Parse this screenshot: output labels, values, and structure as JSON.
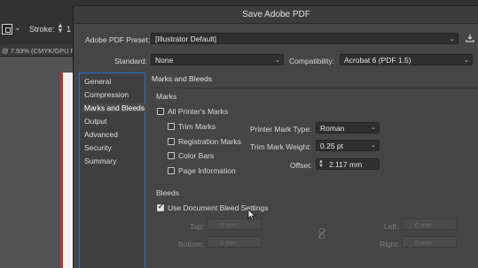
{
  "app": {
    "stroke_label": "Stroke:",
    "stroke_value": "1",
    "doc_tab": "@ 7.93% (CMYK/GPU Pr"
  },
  "dialog": {
    "title": "Save Adobe PDF",
    "preset_label": "Adobe PDF Preset:",
    "preset_value": "[Illustrator Default]",
    "standard_label": "Standard:",
    "standard_value": "None",
    "compat_label": "Compatibility:",
    "compat_value": "Acrobat 6 (PDF 1.5)",
    "sidebar": [
      "General",
      "Compression",
      "Marks and Bleeds",
      "Output",
      "Advanced",
      "Security",
      "Summary"
    ],
    "active_index": 2,
    "panel_title": "Marks and Bleeds",
    "marks": {
      "section": "Marks",
      "all_printers": "All Printer's Marks",
      "trim": "Trim Marks",
      "registration": "Registration Marks",
      "color_bars": "Color Bars",
      "page_info": "Page Information",
      "type_label": "Printer Mark Type:",
      "type_value": "Roman",
      "weight_label": "Trim Mark Weight:",
      "weight_value": "0.25 pt",
      "offset_label": "Offset:",
      "offset_value": "2.117 mm"
    },
    "bleeds": {
      "section": "Bleeds",
      "use_doc": "Use Document Bleed Settings",
      "use_doc_checked": true,
      "top_label": "Top:",
      "top_value": "0 mm",
      "bottom_label": "Bottom:",
      "bottom_value": "0 mm",
      "left_label": "Left:",
      "left_value": "0 mm",
      "right_label": "Right:",
      "right_value": "0 mm"
    }
  },
  "colors": {
    "dialog_bg": "#454545",
    "focus_border": "#1f6fcf",
    "artboard_edge": "#b13b3b"
  }
}
